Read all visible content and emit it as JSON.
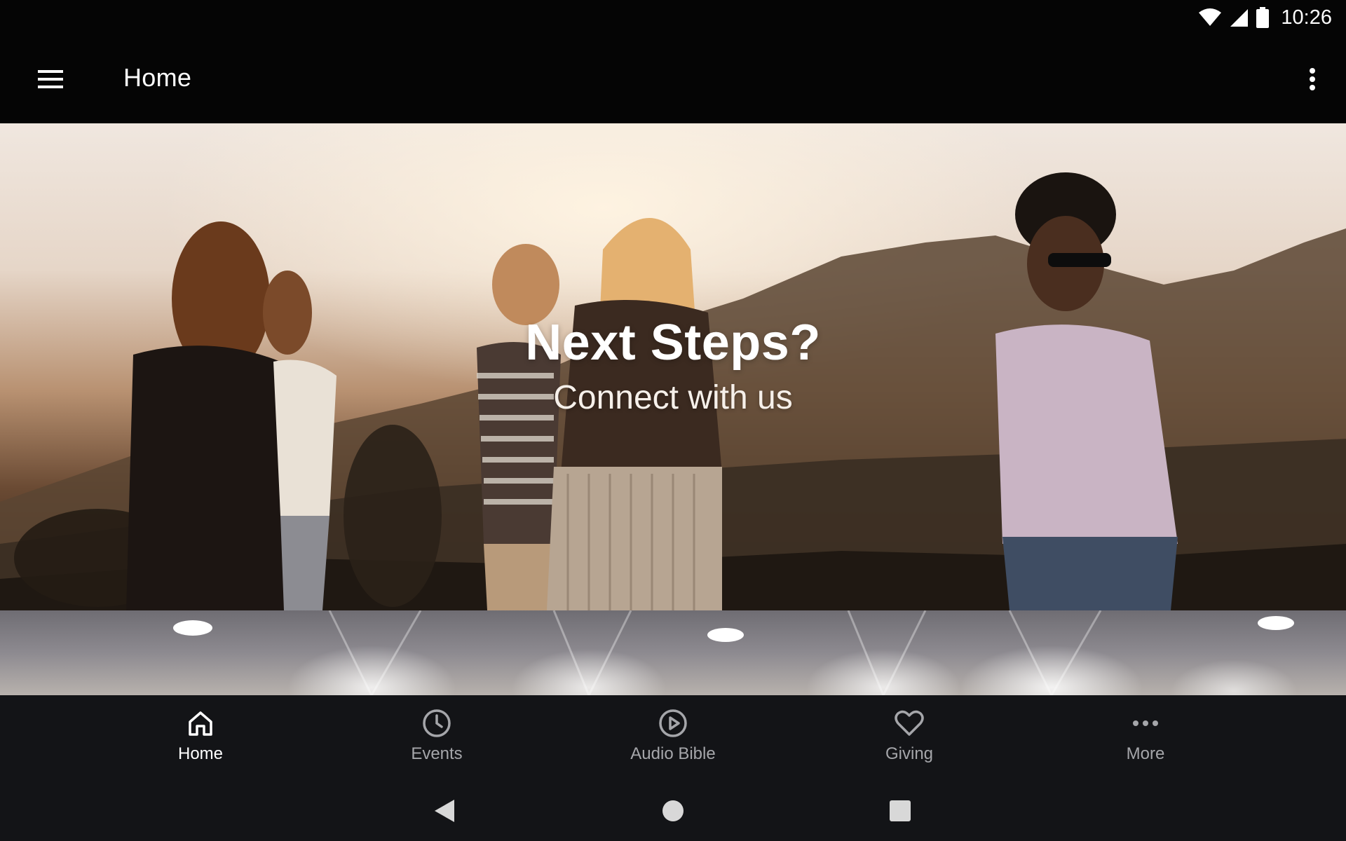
{
  "status_bar": {
    "time": "10:26",
    "icons": [
      "wifi-icon",
      "cellular-signal-icon",
      "battery-icon"
    ]
  },
  "app_bar": {
    "title": "Home",
    "menu_icon": "hamburger-menu-icon",
    "overflow_icon": "more-vertical-icon"
  },
  "hero": {
    "title": "Next Steps?",
    "subtitle": "Connect with us"
  },
  "bottom_nav": {
    "items": [
      {
        "label": "Home",
        "icon": "home-icon",
        "active": true
      },
      {
        "label": "Events",
        "icon": "clock-icon",
        "active": false
      },
      {
        "label": "Audio Bible",
        "icon": "play-circle-icon",
        "active": false
      },
      {
        "label": "Giving",
        "icon": "heart-icon",
        "active": false
      },
      {
        "label": "More",
        "icon": "more-horizontal-icon",
        "active": false
      }
    ]
  },
  "system_nav": {
    "buttons": [
      "back-icon",
      "home-circle-icon",
      "recents-square-icon"
    ]
  },
  "colors": {
    "bar_background": "#050505",
    "nav_background": "#131417",
    "active_label": "#ffffff",
    "inactive_label": "#a5a6aa"
  }
}
